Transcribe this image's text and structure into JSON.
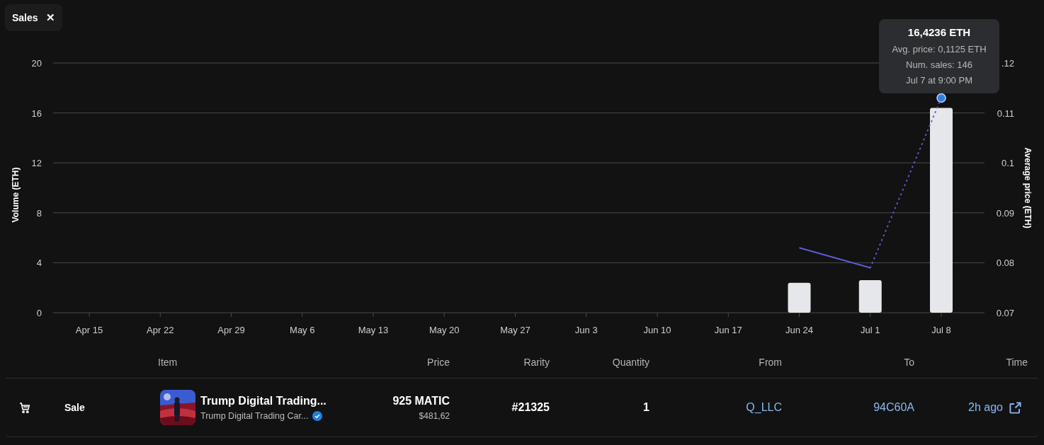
{
  "chip": {
    "label": "Sales",
    "close": "✕"
  },
  "chart": {
    "chart_data": {
      "type": "bar",
      "ylabel": "Volume (ETH)",
      "y2label": "Average price (ETH)",
      "categories": [
        "Apr 15",
        "Apr 22",
        "Apr 29",
        "May 6",
        "May 13",
        "May 20",
        "May 27",
        "Jun 3",
        "Jun 10",
        "Jun 17",
        "Jun 24",
        "Jul 1",
        "Jul 8"
      ],
      "grid": true,
      "ylim": [
        0,
        20
      ],
      "yticks": [
        0,
        4,
        8,
        12,
        16,
        20
      ],
      "y2lim": [
        0.07,
        0.12
      ],
      "y2ticks": [
        {
          "value": 0.07,
          "label": "0.07"
        },
        {
          "value": 0.08,
          "label": "0.08"
        },
        {
          "value": 0.09,
          "label": "0.09"
        },
        {
          "value": 0.1,
          "label": "0.1"
        },
        {
          "value": 0.11,
          "label": "0.11"
        },
        {
          "value": 0.12,
          "label": ".12"
        }
      ],
      "series": [
        {
          "color": "#e5e7ea",
          "values": [
            null,
            null,
            null,
            null,
            null,
            null,
            null,
            null,
            null,
            null,
            2.4,
            2.6,
            16.4
          ]
        },
        {
          "type": "line",
          "color": "#5b5bd6",
          "axis": "y2",
          "values": [
            null,
            null,
            null,
            null,
            null,
            null,
            null,
            null,
            null,
            null,
            0.083,
            0.079,
            0.113
          ]
        }
      ]
    },
    "tooltip": {
      "title": "16,4236 ETH",
      "lines": [
        "Avg. price: 0,1125 ETH",
        "Num. sales: 146",
        "Jul 7 at 9:00 PM"
      ]
    }
  },
  "table": {
    "columns": [
      "Item",
      "Price",
      "Rarity",
      "Quantity",
      "From",
      "To",
      "Time"
    ],
    "rows": [
      {
        "event": "Sale",
        "item_name": "Trump Digital Trading...",
        "item_collection": "Trump Digital Trading Car...",
        "verified": true,
        "price": "925 MATIC",
        "price_usd": "$481,62",
        "rarity": "#21325",
        "quantity": "1",
        "from": "Q_LLC",
        "to": "94C60A",
        "time": "2h ago"
      }
    ]
  }
}
